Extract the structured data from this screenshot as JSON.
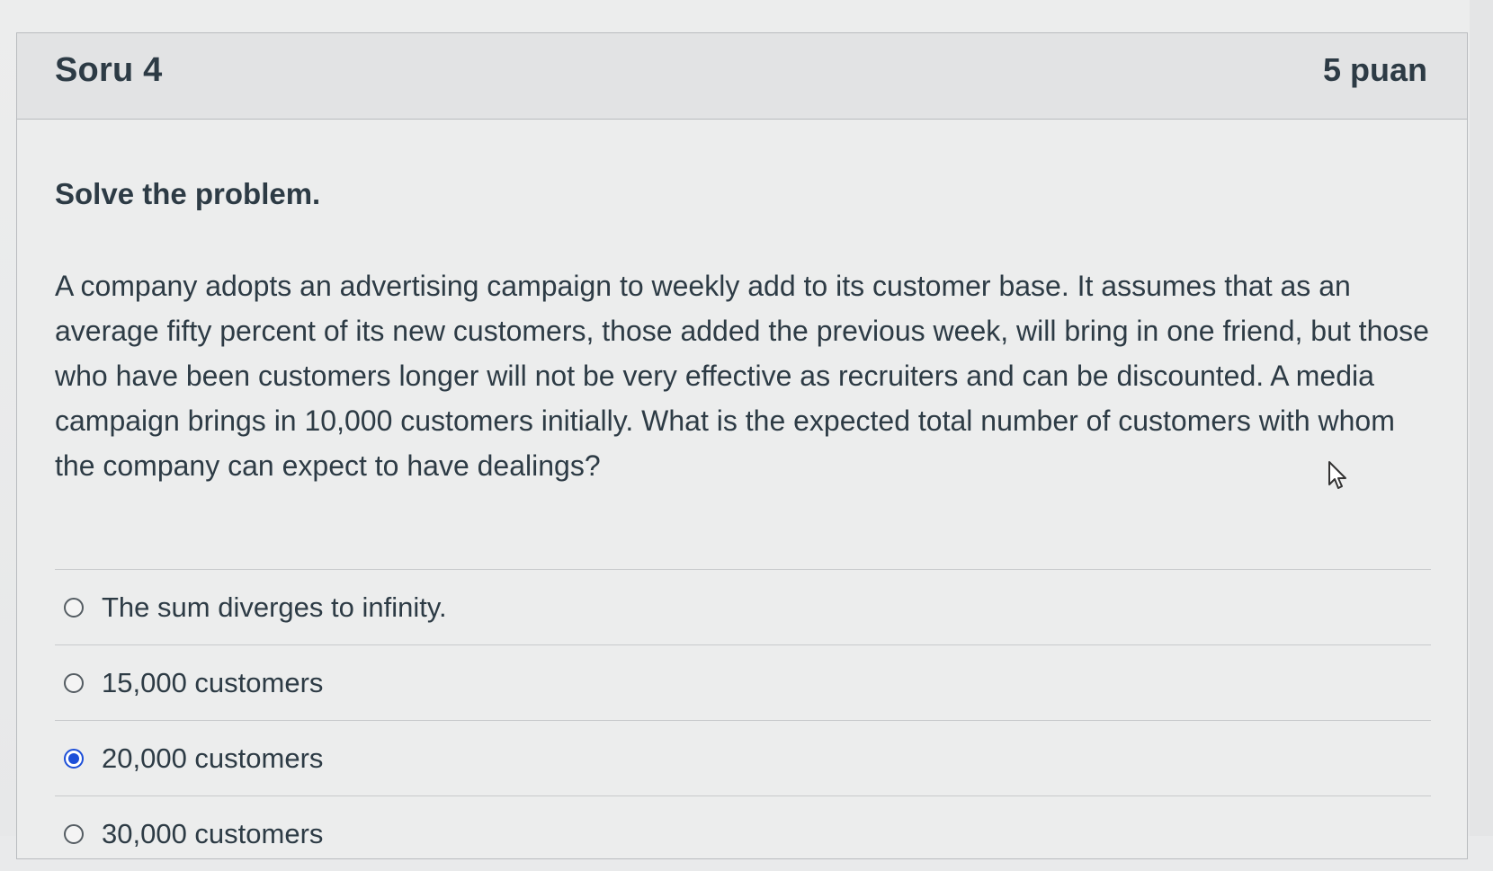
{
  "question": {
    "title": "Soru 4",
    "points": "5 puan",
    "instruction": "Solve the problem.",
    "text": "A company adopts an advertising campaign to weekly add to its customer base. It assumes that as an average fifty percent of its new customers, those added the previous week, will bring in one friend, but those who have been customers longer will not be very effective as recruiters and can be discounted. A media campaign brings in 10,000 customers initially. What is the expected total number of customers with whom the company can expect to have dealings?"
  },
  "answers": [
    {
      "label": "The sum diverges to infinity.",
      "selected": false
    },
    {
      "label": "15,000 customers",
      "selected": false
    },
    {
      "label": "20,000 customers",
      "selected": true
    },
    {
      "label": "30,000 customers",
      "selected": false
    }
  ],
  "colors": {
    "accent": "#1d4fd8",
    "text": "#2d3b45",
    "border": "#b9bcbf"
  },
  "icons": {
    "radio_unchecked": "radio-unchecked-icon",
    "radio_checked": "radio-checked-icon",
    "cursor": "mouse-pointer-icon"
  }
}
